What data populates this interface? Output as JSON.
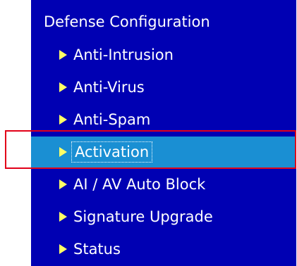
{
  "menu": {
    "title": "Defense Configuration",
    "items": [
      {
        "label": "Anti-Intrusion",
        "icon": "caret-right-icon",
        "selected": false
      },
      {
        "label": "Anti-Virus",
        "icon": "caret-right-icon",
        "selected": false
      },
      {
        "label": "Anti-Spam",
        "icon": "caret-right-icon",
        "selected": false
      },
      {
        "label": "Activation",
        "icon": "caret-right-icon",
        "selected": true
      },
      {
        "label": "AI / AV Auto Block",
        "icon": "caret-right-icon",
        "selected": false
      },
      {
        "label": "Signature Upgrade",
        "icon": "caret-right-icon",
        "selected": false
      },
      {
        "label": "Status",
        "icon": "caret-right-icon",
        "selected": false
      }
    ]
  },
  "colors": {
    "menu_background": "#0000b3",
    "selected_background": "#1a8fd3",
    "arrow": "#ffff66",
    "text": "#ffffff",
    "annotation_border": "#e20018"
  }
}
